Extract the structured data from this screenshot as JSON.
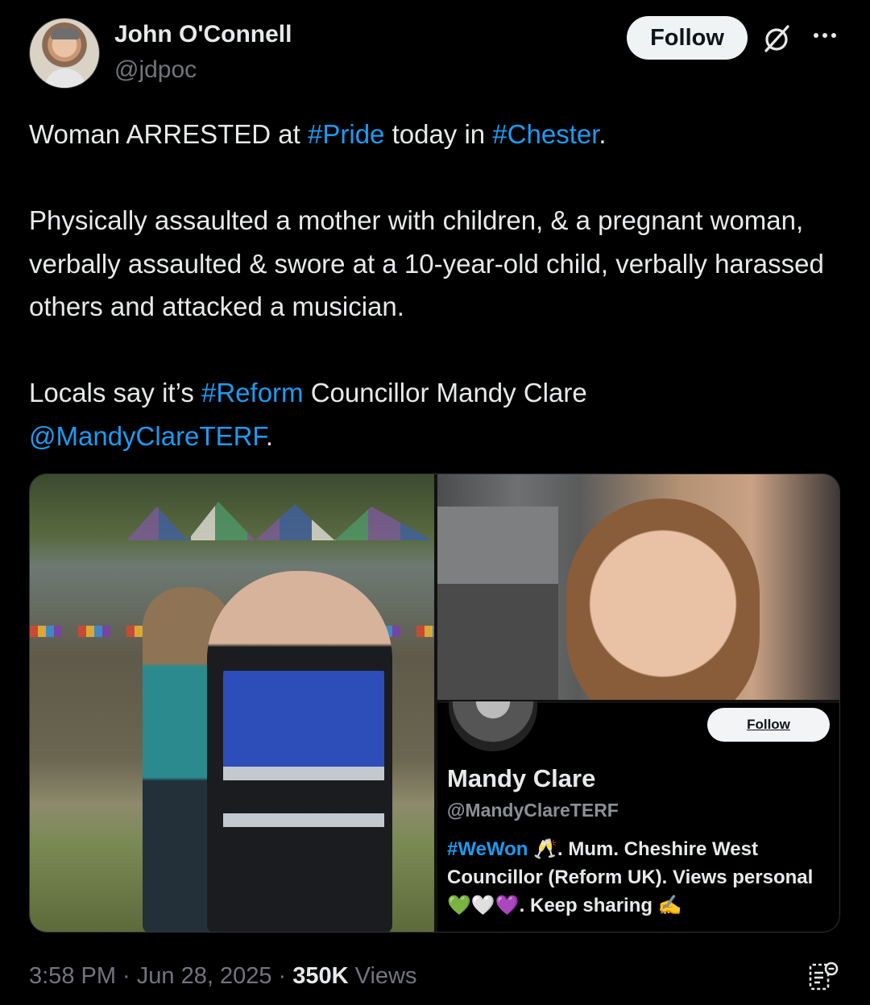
{
  "author": {
    "name": "John O'Connell",
    "handle": "@jdpoc",
    "follow_label": "Follow"
  },
  "icons": {
    "grok": "grok-slash-icon",
    "more": "more-dots-icon",
    "views": "view-count-icon"
  },
  "tweet": {
    "line1": {
      "a": "Woman ARRESTED at ",
      "tag1": "#Pride",
      "b": " today in ",
      "tag2": "#Chester",
      "c": "."
    },
    "para2": "Physically assaulted a mother with children, & a pregnant woman, verbally assaulted & swore at a 10-year-old child, verbally harassed others and attacked a musician.",
    "para3": {
      "a": "Locals say it’s ",
      "tag": "#Reform",
      "b": " Councillor Mandy Clare",
      "mention": "@MandyClareTERF",
      "c": "."
    }
  },
  "embedded_profile": {
    "follow_label": "Follow",
    "name": "Mandy Clare",
    "handle": "@MandyClareTERF",
    "bio_tag": "#WeWon",
    "bio_rest": " 🥂. Mum. Cheshire West Councillor (Reform UK). Views personal 💚🤍💜. Keep sharing ✍️"
  },
  "footer": {
    "time": "3:58 PM",
    "sep1": " · ",
    "date": "Jun 28, 2025",
    "sep2": " · ",
    "views_count": "350K",
    "views_label": " Views"
  },
  "colors": {
    "background": "#000000",
    "text": "#e7e9ea",
    "secondary": "#71767b",
    "link": "#1d9bf0"
  }
}
